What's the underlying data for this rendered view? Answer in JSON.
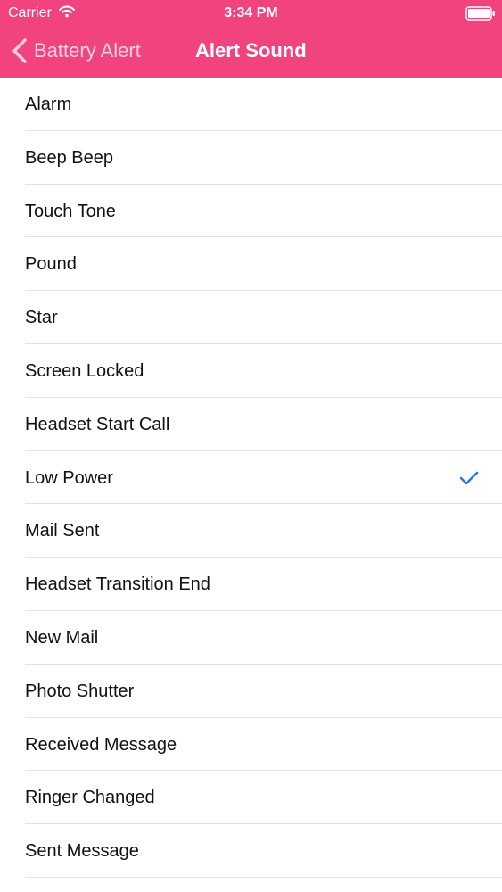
{
  "status_bar": {
    "carrier": "Carrier",
    "time": "3:34 PM"
  },
  "nav": {
    "back_label": "Battery Alert",
    "title": "Alert Sound"
  },
  "colors": {
    "brand": "#f1437e",
    "check": "#2a7ad3"
  },
  "sounds": [
    {
      "label": "Alarm",
      "selected": false
    },
    {
      "label": "Beep Beep",
      "selected": false
    },
    {
      "label": "Touch Tone",
      "selected": false
    },
    {
      "label": "Pound",
      "selected": false
    },
    {
      "label": "Star",
      "selected": false
    },
    {
      "label": "Screen Locked",
      "selected": false
    },
    {
      "label": "Headset Start Call",
      "selected": false
    },
    {
      "label": "Low Power",
      "selected": true
    },
    {
      "label": "Mail Sent",
      "selected": false
    },
    {
      "label": "Headset Transition End",
      "selected": false
    },
    {
      "label": "New Mail",
      "selected": false
    },
    {
      "label": "Photo Shutter",
      "selected": false
    },
    {
      "label": "Received Message",
      "selected": false
    },
    {
      "label": "Ringer Changed",
      "selected": false
    },
    {
      "label": "Sent Message",
      "selected": false
    }
  ]
}
